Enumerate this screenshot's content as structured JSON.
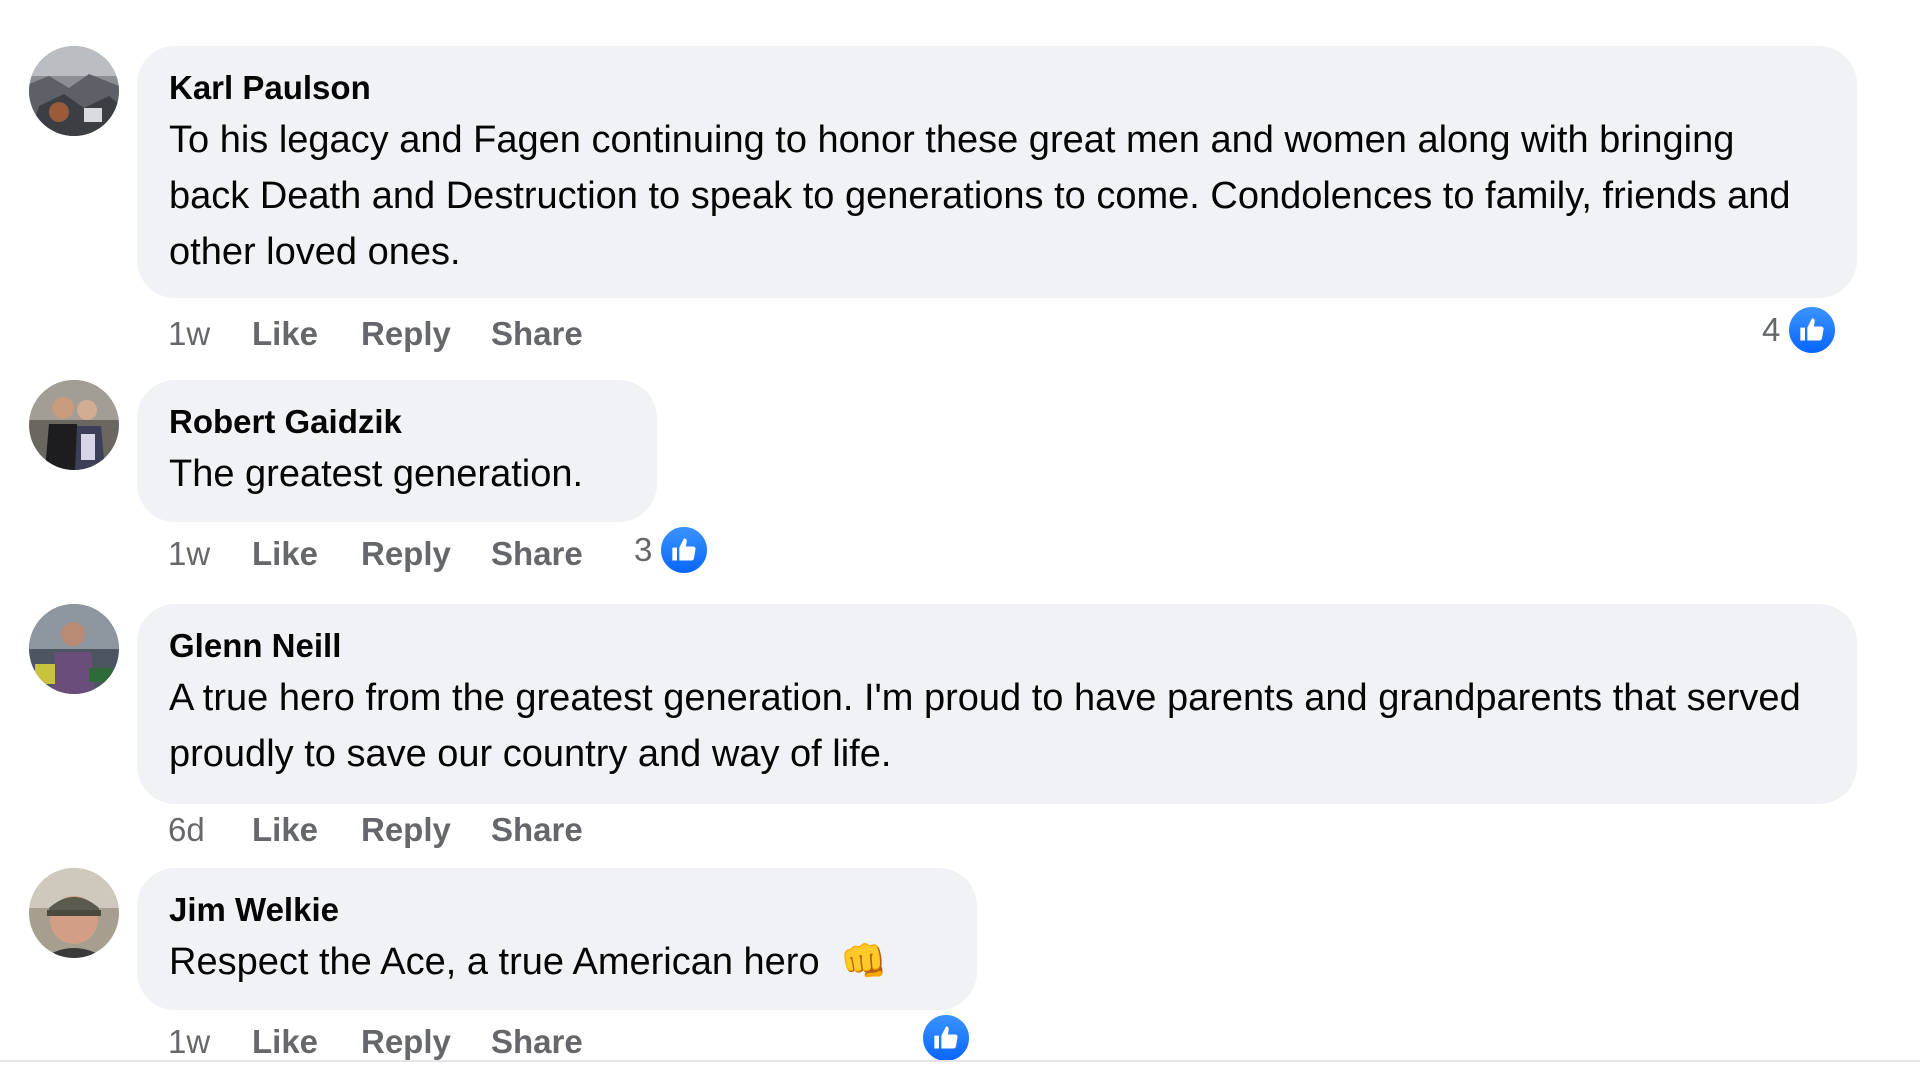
{
  "comments": [
    {
      "author": "Karl Paulson",
      "text": "To his legacy and Fagen continuing to honor these great men and women along with bringing back Death and Destruction to speak to generations to come. Condolences to family, friends and other loved ones.",
      "time": "1w",
      "like_label": "Like",
      "reply_label": "Reply",
      "share_label": "Share",
      "reaction_count": "4"
    },
    {
      "author": "Robert Gaidzik",
      "text": "The greatest generation.",
      "time": "1w",
      "like_label": "Like",
      "reply_label": "Reply",
      "share_label": "Share",
      "reaction_count": "3"
    },
    {
      "author": "Glenn Neill",
      "text": "A true hero from the greatest generation. I'm proud to have parents and grandparents that served proudly to save our country and way of life.",
      "time": "6d",
      "like_label": "Like",
      "reply_label": "Reply",
      "share_label": "Share"
    },
    {
      "author": "Jim Welkie",
      "text": "Respect the Ace, a true American hero",
      "emoji": "👊",
      "time": "1w",
      "like_label": "Like",
      "reply_label": "Reply",
      "share_label": "Share"
    }
  ],
  "icons": {
    "reaction": "like-icon",
    "emoji": "fist-bump-emoji"
  },
  "colors": {
    "bubble": "#f0f2f5",
    "action_text": "#65676b",
    "like_blue": "#0866ff"
  }
}
